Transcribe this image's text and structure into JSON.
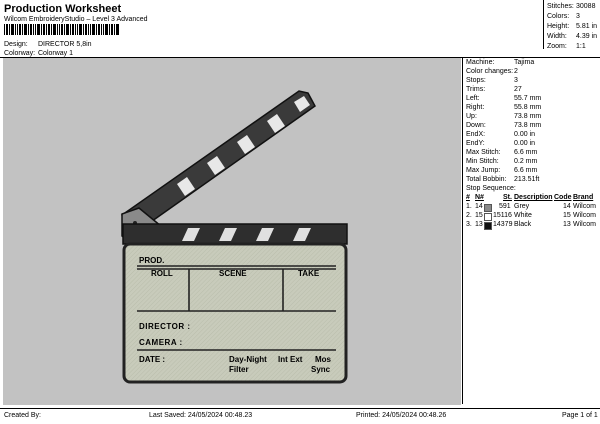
{
  "header": {
    "title": "Production Worksheet",
    "subtitle": "Wilcom EmbroideryStudio – Level 3 Advanced"
  },
  "design_info": [
    {
      "label": "Design:",
      "value": "DIRECTOR 5,8in"
    },
    {
      "label": "Colorway:",
      "value": "Colorway 1"
    }
  ],
  "summary": [
    {
      "label": "Stitches:",
      "value": "30088"
    },
    {
      "label": "Colors:",
      "value": "3"
    },
    {
      "label": "Height:",
      "value": "5.81 in"
    },
    {
      "label": "Width:",
      "value": "4.39 in"
    },
    {
      "label": "Zoom:",
      "value": "1:1"
    }
  ],
  "machine_info": [
    {
      "label": "Machine:",
      "value": "Tajima"
    },
    {
      "label": "Color changes:",
      "value": "2"
    },
    {
      "label": "Stops:",
      "value": "3"
    },
    {
      "label": "Trims:",
      "value": "27"
    },
    {
      "label": "Left:",
      "value": "55.7 mm"
    },
    {
      "label": "Right:",
      "value": "55.8 mm"
    },
    {
      "label": "Up:",
      "value": "73.8 mm"
    },
    {
      "label": "Down:",
      "value": "73.8 mm"
    },
    {
      "label": "EndX:",
      "value": "0.00 in"
    },
    {
      "label": "EndY:",
      "value": "0.00 in"
    },
    {
      "label": "Max Stitch:",
      "value": "6.6 mm"
    },
    {
      "label": "Min Stitch:",
      "value": "0.2 mm"
    },
    {
      "label": "Max Jump:",
      "value": "6.6 mm"
    },
    {
      "label": "Total Bobbin:",
      "value": "213.51ft"
    }
  ],
  "stop_sequence": {
    "title": "Stop Sequence:",
    "headers": [
      "#",
      "N#",
      "St.",
      "Description",
      "Code",
      "Brand"
    ],
    "rows": [
      {
        "num": "1.",
        "needle": "14",
        "color": "#8a8a8a",
        "stitches": "591",
        "description": "Grey",
        "code": "14",
        "brand": "Wilcom"
      },
      {
        "num": "2.",
        "needle": "15",
        "color": "#ffffff",
        "stitches": "15116",
        "description": "White",
        "code": "15",
        "brand": "Wilcom"
      },
      {
        "num": "3.",
        "needle": "13",
        "color": "#111111",
        "stitches": "14379",
        "description": "Black",
        "code": "13",
        "brand": "Wilcom"
      }
    ]
  },
  "clapperboard": {
    "prod": "PROD.",
    "roll": "ROLL",
    "scene": "SCENE",
    "take": "TAKE",
    "director": "DIRECTOR :",
    "camera": "CAMERA :",
    "date": "DATE :",
    "day_night": "Day-Night",
    "int_ext": "Int Ext",
    "mos": "Mos",
    "filter": "Filter",
    "sync": "Sync",
    "board_color": "#c8cbbb",
    "outline_color": "#222222"
  },
  "footer": {
    "created_by": "Created By:",
    "last_saved": "Last Saved: 24/05/2024 00:48.23",
    "printed": "Printed: 24/05/2024 00:48.26",
    "page": "Page 1 of 1"
  }
}
